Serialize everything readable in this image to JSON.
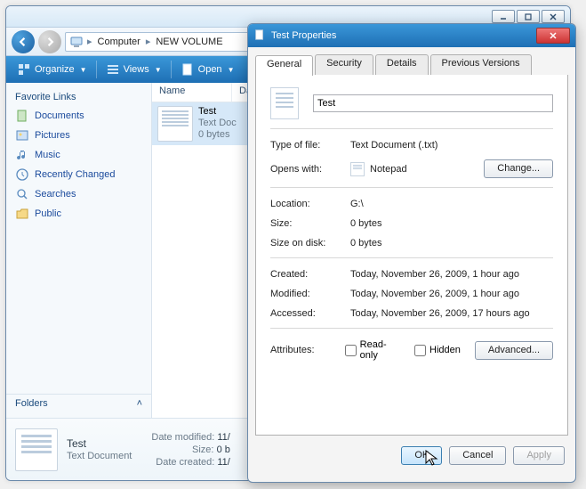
{
  "explorer": {
    "breadcrumb": {
      "root_icon": "computer",
      "items": [
        "Computer",
        "NEW VOLUME"
      ]
    },
    "toolbar": {
      "organize": "Organize",
      "views": "Views",
      "open": "Open"
    },
    "sidebar": {
      "header": "Favorite Links",
      "items": [
        {
          "icon": "documents",
          "label": "Documents"
        },
        {
          "icon": "pictures",
          "label": "Pictures"
        },
        {
          "icon": "music",
          "label": "Music"
        },
        {
          "icon": "recent",
          "label": "Recently Changed"
        },
        {
          "icon": "searches",
          "label": "Searches"
        },
        {
          "icon": "public",
          "label": "Public"
        }
      ],
      "folders_label": "Folders"
    },
    "columns": {
      "name": "Name",
      "date": "Date"
    },
    "file": {
      "name": "Test",
      "type_line": "Text Doc",
      "size_line": "0 bytes"
    },
    "details": {
      "name": "Test",
      "type": "Text Document",
      "modified_label": "Date modified:",
      "modified": "11/",
      "size_label": "Size:",
      "size": "0 b",
      "created_label": "Date created:",
      "created": "11/"
    }
  },
  "dialog": {
    "title": "Test Properties",
    "tabs": [
      "General",
      "Security",
      "Details",
      "Previous Versions"
    ],
    "name_value": "Test",
    "rows": {
      "type_of_file": {
        "label": "Type of file:",
        "value": "Text Document (.txt)"
      },
      "opens_with": {
        "label": "Opens with:",
        "value": "Notepad",
        "change": "Change..."
      },
      "location": {
        "label": "Location:",
        "value": "G:\\"
      },
      "size": {
        "label": "Size:",
        "value": "0 bytes"
      },
      "size_on_disk": {
        "label": "Size on disk:",
        "value": "0 bytes"
      },
      "created": {
        "label": "Created:",
        "value": "Today, November 26, 2009, 1 hour ago"
      },
      "modified": {
        "label": "Modified:",
        "value": "Today, November 26, 2009, 1 hour ago"
      },
      "accessed": {
        "label": "Accessed:",
        "value": "Today, November 26, 2009, 17 hours ago"
      },
      "attributes": {
        "label": "Attributes:",
        "readonly": "Read-only",
        "hidden": "Hidden",
        "advanced": "Advanced..."
      }
    },
    "buttons": {
      "ok": "OK",
      "cancel": "Cancel",
      "apply": "Apply"
    }
  }
}
